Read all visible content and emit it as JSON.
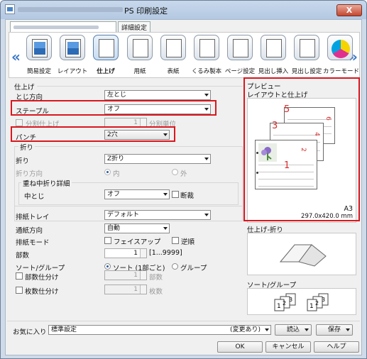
{
  "window": {
    "title": "PS 印刷設定",
    "close_label": "X"
  },
  "tabs": {
    "detail": "詳細設定"
  },
  "iconbar": {
    "items": [
      {
        "label": "簡易設定",
        "icon": "quick-setup-icon"
      },
      {
        "label": "レイアウト",
        "icon": "layout-icon"
      },
      {
        "label": "仕上げ",
        "icon": "finishing-icon",
        "active": true
      },
      {
        "label": "用紙",
        "icon": "paper-icon"
      },
      {
        "label": "表紙",
        "icon": "cover-icon"
      },
      {
        "label": "くるみ製本",
        "icon": "perfect-binding-icon"
      },
      {
        "label": "ページ設定",
        "icon": "page-setup-icon"
      },
      {
        "label": "見出し挿入",
        "icon": "tab-insert-icon"
      },
      {
        "label": "見出し設定",
        "icon": "tab-settings-icon"
      },
      {
        "label": "カラーモード",
        "icon": "color-mode-icon"
      }
    ]
  },
  "finishing": {
    "section": "仕上げ",
    "binding_label": "とじ方向",
    "binding_value": "左とじ",
    "staple_label": "ステープル",
    "staple_value": "オフ",
    "split_label": "分割仕上げ",
    "split_value": "1",
    "split_unit": "分割単位",
    "punch_label": "パンチ",
    "punch_value": "2穴",
    "fold_group": "折り",
    "fold_label": "折り",
    "fold_value": "Z折り",
    "fold_dir_label": "折り方向",
    "fold_dir_in": "内",
    "fold_dir_out": "外",
    "center_fold_group": "重ね中折り詳細",
    "center_label": "中とじ",
    "center_value": "オフ",
    "trim_label": "断裁"
  },
  "output": {
    "tray_label": "排紙トレイ",
    "tray_value": "デフォルト",
    "dir_label": "通紙方向",
    "dir_value": "自動",
    "mode_label": "排紙モード",
    "faceup_label": "フェイスアップ",
    "reverse_label": "逆順",
    "copies_label": "部数",
    "copies_value": "1",
    "copies_range": "[1...9999]",
    "sort_label": "ソート/グループ",
    "sort_label2": "ソート (1部ごと)",
    "group_label": "グループ",
    "offset_copies_label": "部数仕分け",
    "offset_copies_value": "1",
    "offset_copies_unit": "部数",
    "offset_sheets_label": "枚数仕分け",
    "offset_sheets_value": "1",
    "offset_sheets_unit": "枚数"
  },
  "preview": {
    "title": "プレビュー",
    "subtitle": "レイアウトと仕上げ",
    "pages": [
      "5",
      "6",
      "3",
      "4",
      "1",
      "2"
    ],
    "paper_size": "A3",
    "paper_dims": "297.0x420.0 mm",
    "fold_title": "仕上げ-折り",
    "sort_title": "ソート/グループ"
  },
  "favorites": {
    "label": "お気に入り",
    "value": "標準設定",
    "modified": "(変更あり)",
    "load": "読込",
    "save": "保存"
  },
  "footer": {
    "ok": "OK",
    "cancel": "キャンセル",
    "help": "ヘルプ"
  },
  "colors": {
    "highlight": "#d9171e",
    "accent": "#3a77c8"
  }
}
